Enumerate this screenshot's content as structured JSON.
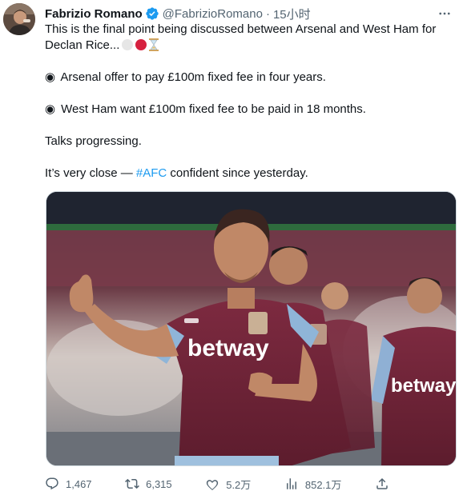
{
  "author": {
    "display_name": "Fabrizio Romano",
    "handle": "@FabrizioRomano",
    "separator": "·",
    "time": "15小时"
  },
  "tweet": {
    "line1": "This is the final point being discussed between Arsenal and West Ham for",
    "line2": "Declan Rice...",
    "bullet1": "Arsenal offer to pay £100m fixed fee in four years.",
    "bullet2": "West Ham want £100m fixed fee to be paid in 18 months.",
    "para3": "Talks progressing.",
    "para4_before": "It’s very close — ",
    "hashtag": "#AFC",
    "para4_after": " confident since yesterday."
  },
  "media": {
    "sponsor_center": "betway",
    "sponsor_right": "betway"
  },
  "actions": {
    "replies": "1,467",
    "retweets": "6,315",
    "likes": "5.2万",
    "views": "852.1万"
  },
  "icons": {
    "verified": "verified-badge-icon",
    "more": "more-options-icon",
    "reply": "reply-icon",
    "retweet": "retweet-icon",
    "like": "heart-icon",
    "views": "views-icon",
    "share": "share-icon"
  },
  "colors": {
    "accent": "#1d9bf0",
    "text": "#0f1419",
    "secondary": "#536471",
    "claret": "#6e2338"
  }
}
